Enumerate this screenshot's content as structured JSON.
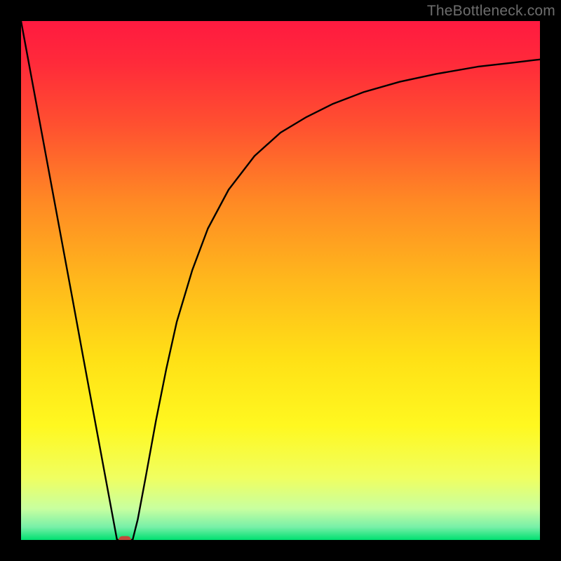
{
  "watermark": "TheBottleneck.com",
  "chart_data": {
    "type": "line",
    "title": "",
    "xlabel": "",
    "ylabel": "",
    "xlim": [
      0,
      100
    ],
    "ylim": [
      0,
      100
    ],
    "grid": false,
    "background_gradient": {
      "stops": [
        {
          "pos": 0.0,
          "color": "#ff1a40"
        },
        {
          "pos": 0.08,
          "color": "#ff2a3a"
        },
        {
          "pos": 0.2,
          "color": "#ff5030"
        },
        {
          "pos": 0.35,
          "color": "#ff8a24"
        },
        {
          "pos": 0.5,
          "color": "#ffb81c"
        },
        {
          "pos": 0.65,
          "color": "#ffe016"
        },
        {
          "pos": 0.78,
          "color": "#fff820"
        },
        {
          "pos": 0.88,
          "color": "#f0ff60"
        },
        {
          "pos": 0.94,
          "color": "#c8ffa0"
        },
        {
          "pos": 0.975,
          "color": "#78f0a8"
        },
        {
          "pos": 1.0,
          "color": "#00e070"
        }
      ]
    },
    "series": [
      {
        "name": "left-branch",
        "color": "#000000",
        "x": [
          0.0,
          2.0,
          4.0,
          6.0,
          8.0,
          10.0,
          12.0,
          14.0,
          16.0,
          17.5,
          18.5
        ],
        "y": [
          100.0,
          89.2,
          78.4,
          67.6,
          56.8,
          46.0,
          35.1,
          24.3,
          13.5,
          5.4,
          0.0
        ]
      },
      {
        "name": "plateau",
        "color": "#000000",
        "x": [
          18.5,
          20.0,
          21.5
        ],
        "y": [
          0.0,
          0.0,
          0.0
        ]
      },
      {
        "name": "right-branch",
        "color": "#000000",
        "x": [
          21.5,
          22.5,
          24.0,
          26.0,
          28.0,
          30.0,
          33.0,
          36.0,
          40.0,
          45.0,
          50.0,
          55.0,
          60.0,
          66.0,
          73.0,
          80.0,
          88.0,
          95.0,
          100.0
        ],
        "y": [
          0.0,
          4.0,
          12.0,
          23.0,
          33.0,
          42.0,
          52.0,
          60.0,
          67.5,
          74.0,
          78.5,
          81.5,
          84.0,
          86.3,
          88.3,
          89.8,
          91.2,
          92.0,
          92.6
        ]
      }
    ],
    "marker": {
      "shape": "rounded-rect",
      "x": 20.0,
      "y": 0.0,
      "width": 2.4,
      "height": 1.5,
      "fill": "#c14b3b"
    }
  }
}
